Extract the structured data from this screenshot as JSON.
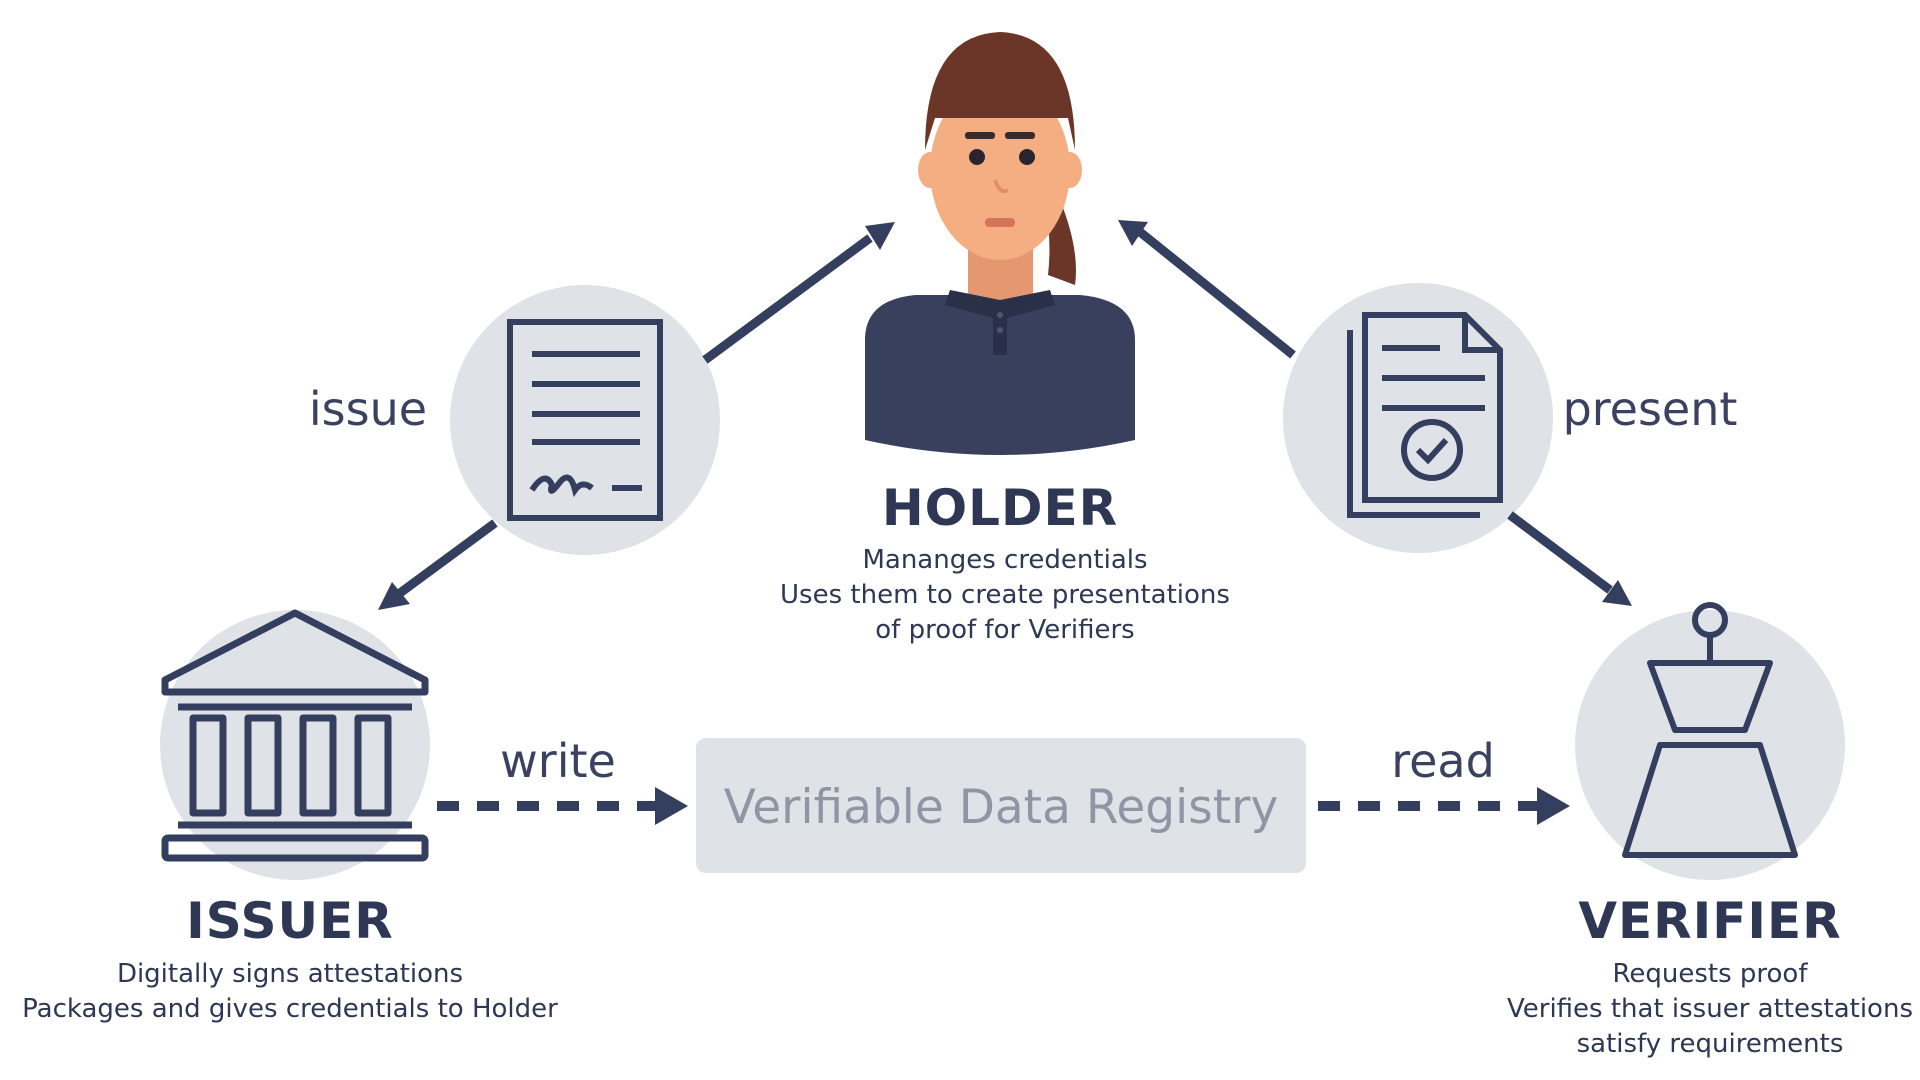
{
  "holder": {
    "title": "HOLDER",
    "lines": [
      "Mananges credentials",
      "Uses them to create presentations",
      "of proof for Verifiers"
    ]
  },
  "issuer": {
    "title": "ISSUER",
    "lines": [
      "Digitally signs attestations",
      "Packages and gives credentials to Holder"
    ]
  },
  "verifier": {
    "title": "VERIFIER",
    "lines": [
      "Requests proof",
      "Verifies that issuer attestations",
      "satisfy requirements"
    ]
  },
  "edges": {
    "issue": "issue",
    "present": "present",
    "write": "write",
    "read": "read"
  },
  "registry": {
    "label": "Verifiable Data Registry"
  },
  "icons": {
    "holder": "person-icon",
    "issuer": "bank-building-icon",
    "verifier": "scale-weight-icon",
    "issue_doc": "signed-document-icon",
    "present_doc": "verified-documents-icon"
  },
  "colors": {
    "navy": "#343e5e",
    "circle": "#dfe2e7",
    "registry_fill": "#dfe2e7",
    "registry_text": "#8e96a6",
    "hair": "#6b3628",
    "skin": "#f4ae82"
  }
}
